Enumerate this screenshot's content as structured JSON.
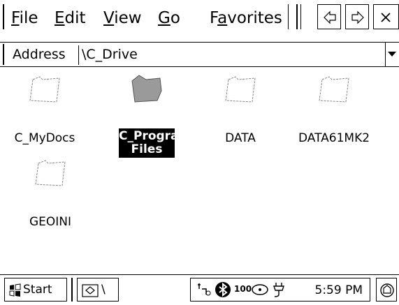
{
  "menubar": {
    "menus": [
      {
        "accel": "F",
        "rest": "ile"
      },
      {
        "accel": "E",
        "rest": "dit"
      },
      {
        "accel": "V",
        "rest": "iew"
      },
      {
        "accel": "G",
        "rest": "o"
      },
      {
        "pre": "F",
        "accel": "a",
        "rest": "vorites"
      }
    ],
    "buttons": [
      "back-icon",
      "forward-icon",
      "close-icon"
    ]
  },
  "address": {
    "label": "Address",
    "value": "\\C_Drive"
  },
  "files": [
    {
      "name": "C_MyDocs",
      "selected": false
    },
    {
      "name": "C_Program Files",
      "line1": "C_Program",
      "line2": "Files",
      "selected": true
    },
    {
      "name": "DATA",
      "selected": false
    },
    {
      "name": "DATA61MK2",
      "selected": false
    },
    {
      "name": "GEOINI",
      "selected": false
    }
  ],
  "taskbar": {
    "start_label": "Start",
    "task_label": "\\",
    "clock": "5:59 PM",
    "battery_text": "100"
  },
  "colors": {
    "selection_bg": "#000000",
    "selection_fg": "#ffffff",
    "folder_selected_fill": "#9a9a9a"
  }
}
